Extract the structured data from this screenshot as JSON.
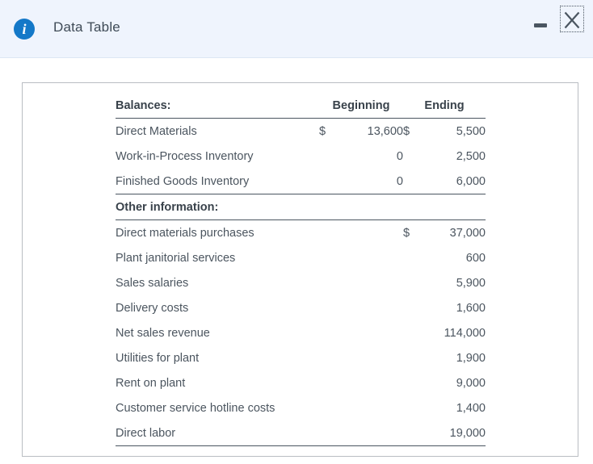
{
  "window": {
    "title": "Data Table",
    "info_icon": "info-icon",
    "minimize_label": "Minimize",
    "close_label": "Close",
    "header_bg": "#eff4fd",
    "accent": "#1478c8"
  },
  "table": {
    "sections": [
      {
        "heading": "Balances:",
        "columns": [
          "Beginning",
          "Ending"
        ],
        "rows": [
          {
            "label": "Direct Materials",
            "beg_sym": "$",
            "beg": "13,600",
            "end_sym": "$",
            "end": "5,500"
          },
          {
            "label": "Work-in-Process Inventory",
            "beg_sym": "",
            "beg": "0",
            "end_sym": "",
            "end": "2,500"
          },
          {
            "label": "Finished Goods Inventory",
            "beg_sym": "",
            "beg": "0",
            "end_sym": "",
            "end": "6,000"
          }
        ]
      },
      {
        "heading": "Other information:",
        "rows": [
          {
            "label": "Direct materials purchases",
            "sym": "$",
            "value": "37,000"
          },
          {
            "label": "Plant janitorial services",
            "sym": "",
            "value": "600"
          },
          {
            "label": "Sales salaries",
            "sym": "",
            "value": "5,900"
          },
          {
            "label": "Delivery costs",
            "sym": "",
            "value": "1,600"
          },
          {
            "label": "Net sales revenue",
            "sym": "",
            "value": "114,000"
          },
          {
            "label": "Utilities for plant",
            "sym": "",
            "value": "1,900"
          },
          {
            "label": "Rent on plant",
            "sym": "",
            "value": "9,000"
          },
          {
            "label": "Customer service hotline costs",
            "sym": "",
            "value": "1,400"
          },
          {
            "label": "Direct labor",
            "sym": "",
            "value": "19,000"
          }
        ]
      }
    ]
  }
}
